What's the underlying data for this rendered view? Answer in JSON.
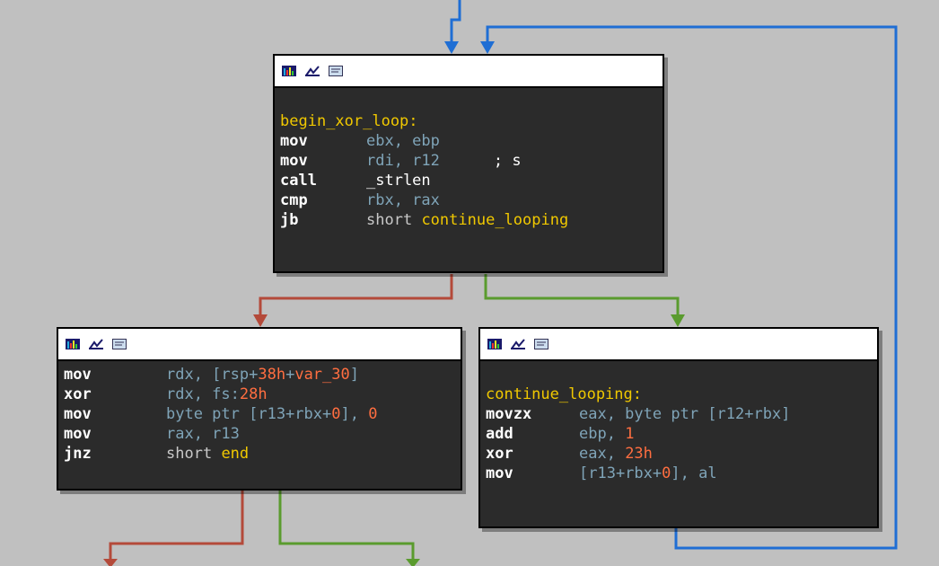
{
  "colors": {
    "canvas": "#c0c0c0",
    "node_bg": "#2b2b2b",
    "edge_false": "#b44a3a",
    "edge_true": "#5a9b2e",
    "edge_loop": "#1f6ed4"
  },
  "header_icons": [
    "graph-color-icon",
    "graph-edit-icon",
    "graph-text-icon"
  ],
  "nodes": {
    "begin": {
      "label": "begin_xor_loop:",
      "lines": [
        {
          "mnemonic": "mov",
          "operands": "ebx, ebp"
        },
        {
          "mnemonic": "mov",
          "operands": "rdi, r12",
          "comment": "; s"
        },
        {
          "mnemonic": "call",
          "operands": "_strlen"
        },
        {
          "mnemonic": "cmp",
          "operands": "rbx, rax"
        },
        {
          "mnemonic": "jb",
          "prefix": "short",
          "target": "continue_looping"
        }
      ]
    },
    "left": {
      "lines": [
        {
          "mnemonic": "mov",
          "op1": "rdx, [rsp+",
          "num1": "38h",
          "op2": "+",
          "var1": "var_30",
          "op3": "]"
        },
        {
          "mnemonic": "xor",
          "op1": "rdx, fs:",
          "num1": "28h"
        },
        {
          "mnemonic": "mov",
          "op1": "byte ptr [r13+rbx+",
          "num1": "0",
          "op2": "], ",
          "num2": "0"
        },
        {
          "mnemonic": "mov",
          "op1": "rax, r13"
        },
        {
          "mnemonic": "jnz",
          "prefix": "short",
          "target": "end"
        }
      ]
    },
    "right": {
      "label": "continue_looping:",
      "lines": [
        {
          "mnemonic": "movzx",
          "op1": "eax, byte ptr [r12+rbx]"
        },
        {
          "mnemonic": "add",
          "op1": "ebp, ",
          "num1": "1"
        },
        {
          "mnemonic": "xor",
          "op1": "eax, ",
          "num1": "23h"
        },
        {
          "mnemonic": "mov",
          "op1": "[r13+rbx+",
          "num1": "0",
          "op2": "], al"
        }
      ]
    }
  }
}
